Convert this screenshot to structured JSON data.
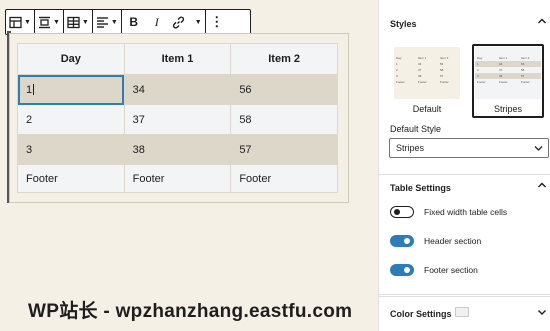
{
  "toolbar": {
    "items": [
      "table-icon",
      "align-center-icon",
      "edit-table-icon",
      "text-align-icon",
      "bold-icon",
      "italic-icon",
      "link-icon",
      "more-options-icon"
    ],
    "bold_label": "B",
    "italic_label": "I",
    "more_label": "⋮"
  },
  "table": {
    "header": [
      "Day",
      "Item 1",
      "Item 2"
    ],
    "rows": [
      [
        "1",
        "34",
        "56"
      ],
      [
        "2",
        "37",
        "58"
      ],
      [
        "3",
        "38",
        "57"
      ]
    ],
    "footer": [
      "Footer",
      "Footer",
      "Footer"
    ],
    "selected_cell": "1"
  },
  "sidebar": {
    "styles": {
      "title": "Styles",
      "options": [
        {
          "label": "Default",
          "selected": false
        },
        {
          "label": "Stripes",
          "selected": true
        }
      ],
      "default_style_label": "Default Style",
      "default_style_value": "Stripes"
    },
    "table_settings": {
      "title": "Table Settings",
      "toggles": [
        {
          "label": "Fixed width table cells",
          "on": false
        },
        {
          "label": "Header section",
          "on": true
        },
        {
          "label": "Footer section",
          "on": true
        }
      ]
    },
    "color_settings": {
      "title": "Color Settings"
    }
  },
  "watermark": "WP站长 - wpzhanzhang.eastfu.com",
  "colors": {
    "accent": "#2d7db8",
    "stripe": "#dcd7c9",
    "row_light": "#f2f4f6",
    "canvas": "#f5f0e5"
  }
}
